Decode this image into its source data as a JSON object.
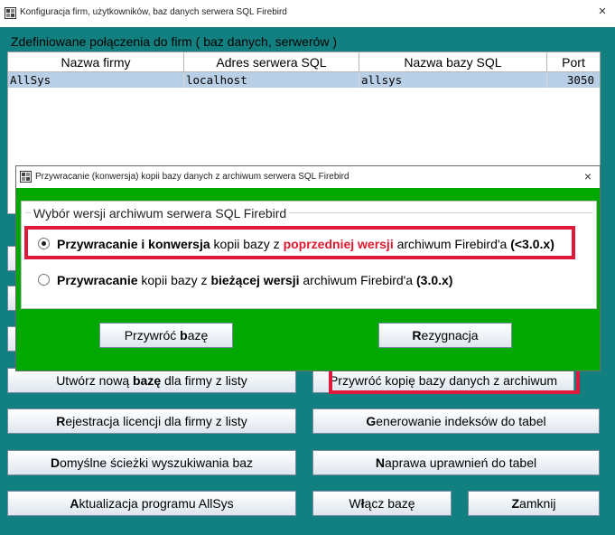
{
  "window": {
    "title": "Konfiguracja firm, użytkowników, baz danych serwera SQL Firebird",
    "close": "×"
  },
  "caption": "Zdefiniowane połączenia do firm ( baz danych, serwerów )",
  "table": {
    "columns": [
      "Nazwa firmy",
      "Adres serwera SQL",
      "Nazwa bazy SQL",
      "Port"
    ],
    "rows": [
      [
        "AllSys",
        "localhost",
        "allsys",
        "3050"
      ]
    ]
  },
  "buttons": {
    "create_db": {
      "prefix": "Utwórz nową ",
      "bold": "bazę",
      "suffix": " dla firmy z listy"
    },
    "restore_archive": "Przywróć kopię bazy danych z archiwum",
    "license": {
      "bold": "R",
      "rest": "ejestracja licencji dla firmy z listy"
    },
    "indexes": {
      "bold": "G",
      "rest": "enerowanie indeksów do tabel"
    },
    "paths": {
      "bold": "D",
      "rest": "omyślne ścieżki wyszukiwania baz"
    },
    "permissions": {
      "bold": "N",
      "rest": "aprawa uprawnień do tabel"
    },
    "update": {
      "bold": "A",
      "rest": "ktualizacja programu AllSys"
    },
    "enable_db": {
      "prefix": "W",
      "bold": "ł",
      "suffix": "ącz bazę"
    },
    "close": {
      "bold": "Z",
      "rest": "amknij"
    }
  },
  "dialog": {
    "title": "Przywracanie (konwersja) kopii bazy danych z archiwum serwera SQL Firebird",
    "close": "×",
    "group_label": "Wybór wersji archiwum serwera SQL Firebird",
    "option1": {
      "selected": true,
      "bold1": "Przywracanie i konwersja",
      "text1": " kopii bazy z ",
      "red": "poprzedniej wersji",
      "text2": " archiwum Firebird'a ",
      "bold2": "(<3.0.x)"
    },
    "option2": {
      "selected": false,
      "bold1": "Przywracanie",
      "text1": " kopii bazy z ",
      "bold_mid": "bieżącej wersji",
      "text2": " archiwum Firebird'a ",
      "bold2": "(3.0.x)"
    },
    "restore_button": {
      "prefix": "Przywróć ",
      "bold": "b",
      "suffix": "azę"
    },
    "cancel_button": {
      "bold": "R",
      "rest": "ezygnacja"
    }
  },
  "colors": {
    "background": "#128080",
    "dialog_background": "#01a801",
    "highlight": "#e0193a",
    "selected_row": "#b8cfe5"
  }
}
